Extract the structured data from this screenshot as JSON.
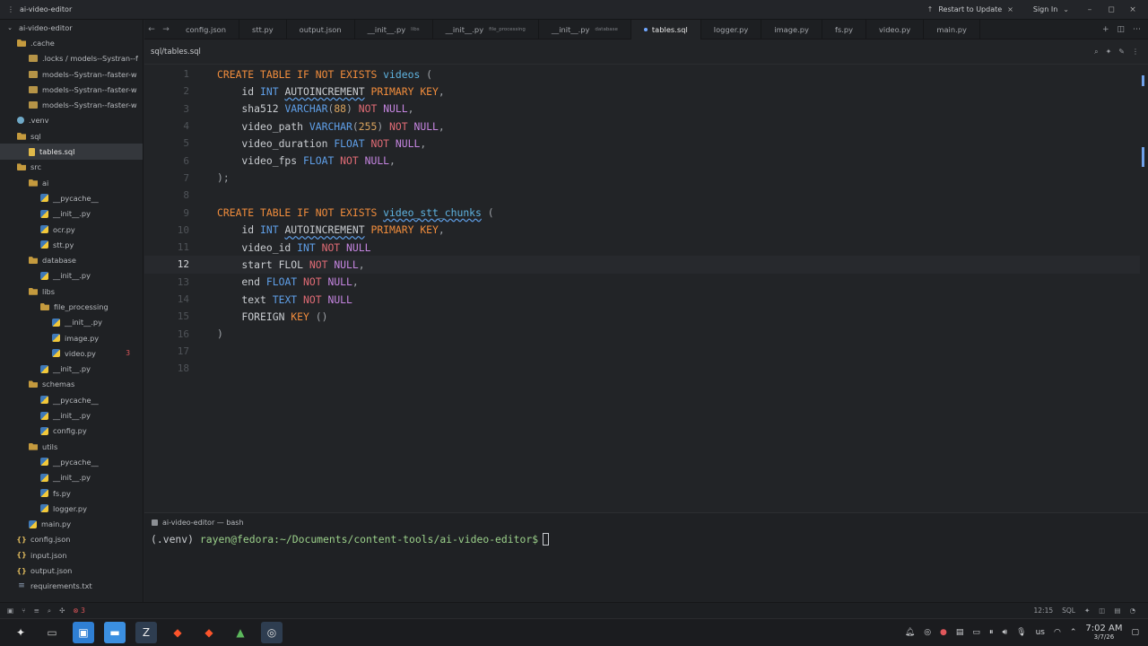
{
  "titlebar": {
    "project": "ai-video-editor",
    "restart": "Restart to Update",
    "sign_in": "Sign In"
  },
  "sidebar": {
    "items": [
      {
        "label": "ai-video-editor",
        "icon": "chevron",
        "depth": 0
      },
      {
        "label": ".cache",
        "icon": "folderopen",
        "depth": 1
      },
      {
        "label": ".locks / models--Systran--f",
        "icon": "folder",
        "depth": 2
      },
      {
        "label": "models--Systran--faster-w",
        "icon": "folder",
        "depth": 2
      },
      {
        "label": "models--Systran--faster-w",
        "icon": "folder",
        "depth": 2
      },
      {
        "label": "models--Systran--faster-w",
        "icon": "folder",
        "depth": 2
      },
      {
        "label": ".venv",
        "icon": "venv",
        "depth": 1
      },
      {
        "label": "sql",
        "icon": "folderopen",
        "depth": 1
      },
      {
        "label": "tables.sql",
        "icon": "sql",
        "depth": 2,
        "selected": true
      },
      {
        "label": "src",
        "icon": "folderopen",
        "depth": 1
      },
      {
        "label": "ai",
        "icon": "folderopen",
        "depth": 2
      },
      {
        "label": "__pycache__",
        "icon": "py",
        "depth": 3
      },
      {
        "label": "__init__.py",
        "icon": "py",
        "depth": 3
      },
      {
        "label": "ocr.py",
        "icon": "py",
        "depth": 3
      },
      {
        "label": "stt.py",
        "icon": "py",
        "depth": 3
      },
      {
        "label": "database",
        "icon": "folderopen",
        "depth": 2
      },
      {
        "label": "__init__.py",
        "icon": "py",
        "depth": 3
      },
      {
        "label": "libs",
        "icon": "folderopen",
        "depth": 2
      },
      {
        "label": "file_processing",
        "icon": "folderopen",
        "depth": 3
      },
      {
        "label": "__init__.py",
        "icon": "py",
        "depth": 4
      },
      {
        "label": "image.py",
        "icon": "py",
        "depth": 4
      },
      {
        "label": "video.py",
        "icon": "py",
        "depth": 4,
        "badge": "3"
      },
      {
        "label": "__init__.py",
        "icon": "py",
        "depth": 3
      },
      {
        "label": "schemas",
        "icon": "folderopen",
        "depth": 2
      },
      {
        "label": "__pycache__",
        "icon": "py",
        "depth": 3
      },
      {
        "label": "__init__.py",
        "icon": "py",
        "depth": 3
      },
      {
        "label": "config.py",
        "icon": "py",
        "depth": 3
      },
      {
        "label": "utils",
        "icon": "folderopen",
        "depth": 2
      },
      {
        "label": "__pycache__",
        "icon": "py",
        "depth": 3
      },
      {
        "label": "__init__.py",
        "icon": "py",
        "depth": 3
      },
      {
        "label": "fs.py",
        "icon": "py",
        "depth": 3
      },
      {
        "label": "logger.py",
        "icon": "py",
        "depth": 3
      },
      {
        "label": "main.py",
        "icon": "py",
        "depth": 2
      },
      {
        "label": "config.json",
        "icon": "json",
        "depth": 1
      },
      {
        "label": "input.json",
        "icon": "json",
        "depth": 1
      },
      {
        "label": "output.json",
        "icon": "json",
        "depth": 1
      },
      {
        "label": "requirements.txt",
        "icon": "txt",
        "depth": 1
      }
    ]
  },
  "tabs": [
    {
      "label": "config.json"
    },
    {
      "label": "stt.py"
    },
    {
      "label": "output.json"
    },
    {
      "label": "__init__.py",
      "sub": "libs"
    },
    {
      "label": "__init__.py",
      "sub": "file_processing"
    },
    {
      "label": "__init__.py",
      "sub": "database"
    },
    {
      "label": "tables.sql",
      "active": true
    },
    {
      "label": "logger.py"
    },
    {
      "label": "image.py"
    },
    {
      "label": "fs.py"
    },
    {
      "label": "video.py"
    },
    {
      "label": "main.py"
    }
  ],
  "breadcrumb": "sql/tables.sql",
  "editor": {
    "current_line": 12,
    "lines": [
      [
        [
          "k",
          "CREATE TABLE IF NOT EXISTS "
        ],
        [
          "tb",
          "videos"
        ],
        [
          "p",
          " ("
        ]
      ],
      [
        [
          "c",
          "    id "
        ],
        [
          "t",
          "INT "
        ],
        [
          "sq",
          "AUTOINCREMENT"
        ],
        [
          "k",
          " PRIMARY KEY"
        ],
        [
          "p",
          ","
        ]
      ],
      [
        [
          "c",
          "    sha512 "
        ],
        [
          "t",
          "VARCHAR"
        ],
        [
          "p",
          "("
        ],
        [
          "num",
          "88"
        ],
        [
          "p",
          ") "
        ],
        [
          "n",
          "NOT "
        ],
        [
          "nl",
          "NULL"
        ],
        [
          "p",
          ","
        ]
      ],
      [
        [
          "c",
          "    video_path "
        ],
        [
          "t",
          "VARCHAR"
        ],
        [
          "p",
          "("
        ],
        [
          "num",
          "255"
        ],
        [
          "p",
          ") "
        ],
        [
          "n",
          "NOT "
        ],
        [
          "nl",
          "NULL"
        ],
        [
          "p",
          ","
        ]
      ],
      [
        [
          "c",
          "    video_duration "
        ],
        [
          "t",
          "FLOAT "
        ],
        [
          "n",
          "NOT "
        ],
        [
          "nl",
          "NULL"
        ],
        [
          "p",
          ","
        ]
      ],
      [
        [
          "c",
          "    video_fps "
        ],
        [
          "t",
          "FLOAT "
        ],
        [
          "n",
          "NOT "
        ],
        [
          "nl",
          "NULL"
        ],
        [
          "p",
          ","
        ]
      ],
      [
        [
          "p",
          ");"
        ]
      ],
      [],
      [
        [
          "k",
          "CREATE TABLE IF NOT EXISTS "
        ],
        [
          "tbsq",
          "video_stt_chunks"
        ],
        [
          "p",
          " ("
        ]
      ],
      [
        [
          "c",
          "    id "
        ],
        [
          "t",
          "INT "
        ],
        [
          "sq",
          "AUTOINCREMENT"
        ],
        [
          "k",
          " PRIMARY KEY"
        ],
        [
          "p",
          ","
        ]
      ],
      [
        [
          "c",
          "    video_id "
        ],
        [
          "t",
          "INT "
        ],
        [
          "n",
          "NOT "
        ],
        [
          "nl",
          "NULL"
        ]
      ],
      [
        [
          "c",
          "    start FLOL "
        ],
        [
          "n",
          "NOT "
        ],
        [
          "nl",
          "NULL"
        ],
        [
          "p",
          ","
        ]
      ],
      [
        [
          "c",
          "    end "
        ],
        [
          "t",
          "FLOAT "
        ],
        [
          "n",
          "NOT "
        ],
        [
          "nl",
          "NULL"
        ],
        [
          "p",
          ","
        ]
      ],
      [
        [
          "c",
          "    text "
        ],
        [
          "t",
          "TEXT "
        ],
        [
          "n",
          "NOT "
        ],
        [
          "nl",
          "NULL"
        ]
      ],
      [
        [
          "c",
          "    FOREIGN "
        ],
        [
          "k",
          "KEY "
        ],
        [
          "p",
          "()"
        ]
      ],
      [
        [
          "p",
          ")"
        ]
      ],
      [],
      []
    ]
  },
  "terminal": {
    "tab_title": "ai-video-editor — bash",
    "prompt_env": "(.venv) ",
    "prompt_user": "rayen@fedora:~/Documents/content-tools/ai-video-editor$"
  },
  "status": {
    "errors": "3",
    "position": "12:15",
    "language": "SQL"
  },
  "taskbar": {
    "time": "7:02 AM",
    "date": "3/7/26",
    "keyboard": "us"
  }
}
